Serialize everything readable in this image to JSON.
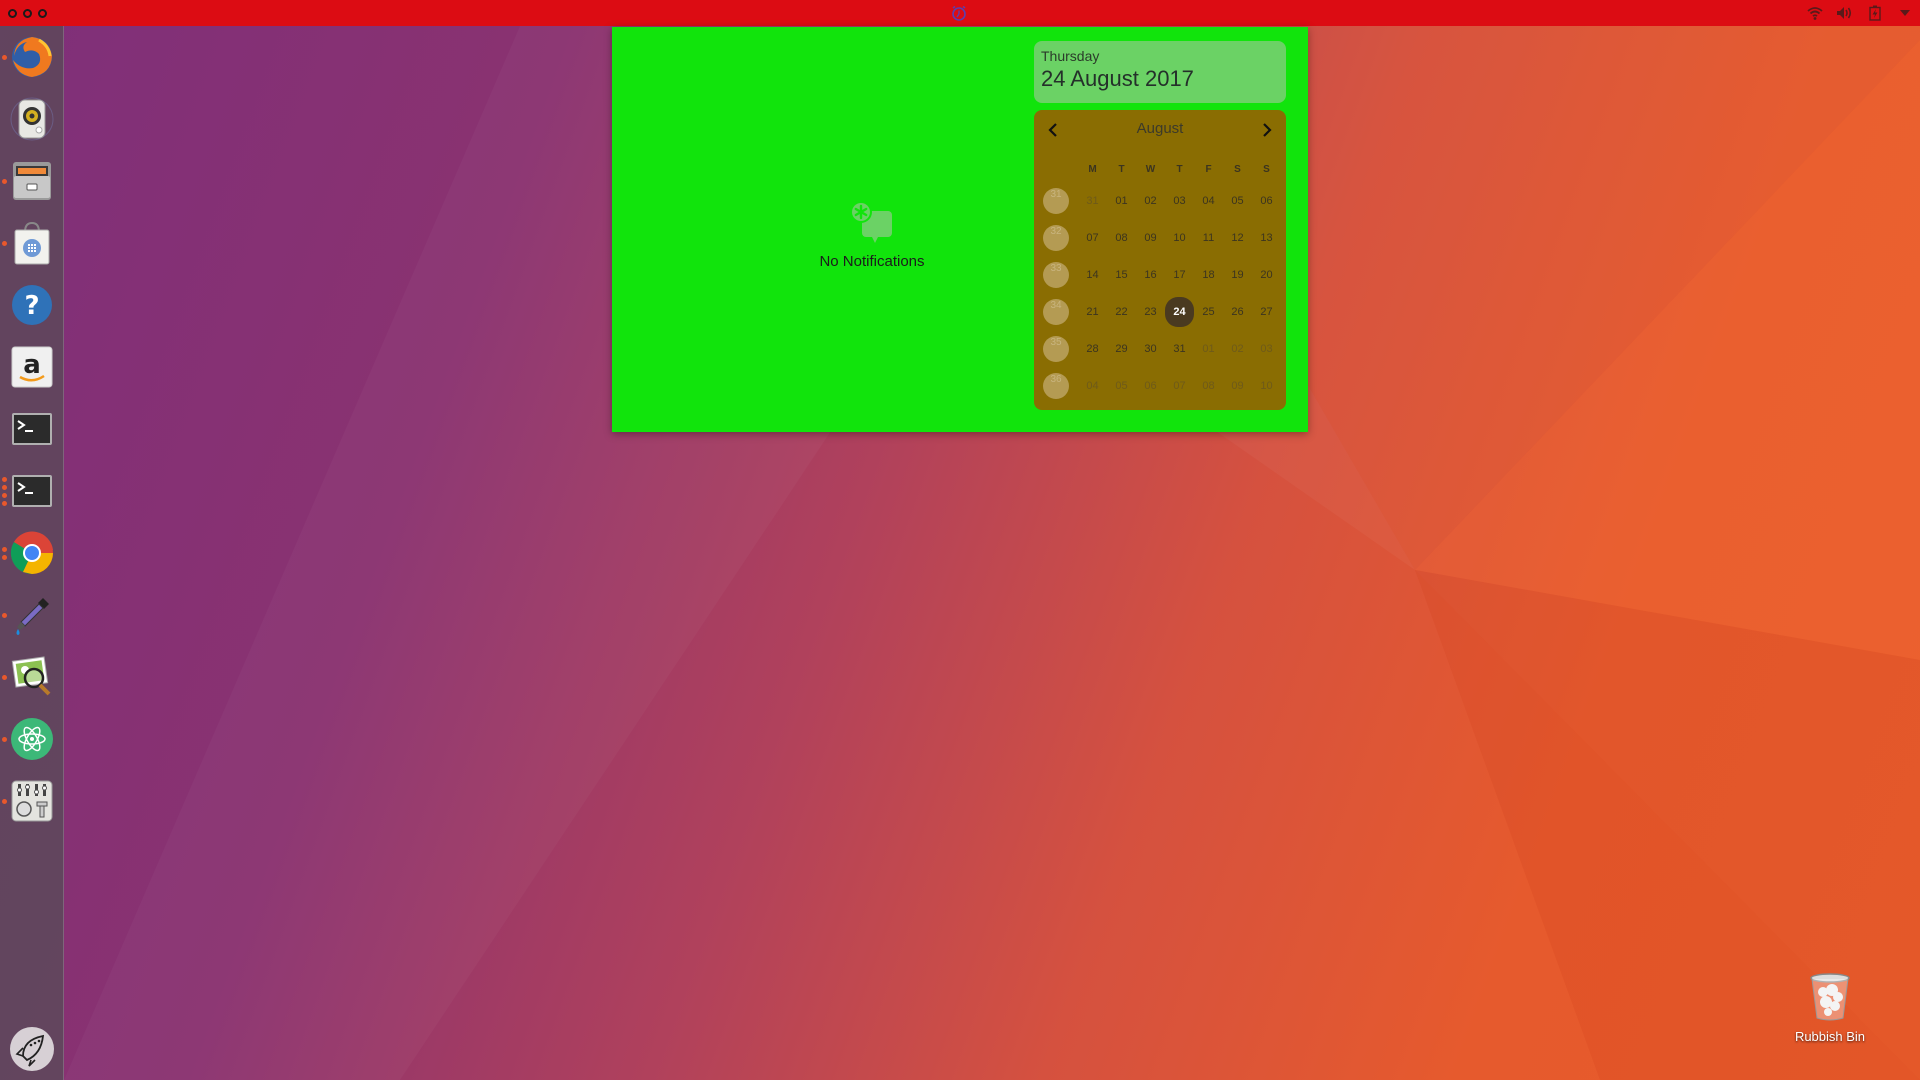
{
  "top_panel": {
    "window_controls": [
      "close",
      "minimize",
      "maximize"
    ],
    "center_indicator": "alarm-clock-icon",
    "indicators": [
      "network-wifi-icon",
      "volume-icon",
      "battery-charging-icon",
      "system-menu-chevron-icon"
    ]
  },
  "launcher": {
    "items": [
      {
        "name": "Firefox Web Browser",
        "icon": "firefox-icon",
        "running_pips": 1
      },
      {
        "name": "Rhythmbox",
        "icon": "speaker-icon",
        "running_pips": 0
      },
      {
        "name": "Files",
        "icon": "file-cabinet-icon",
        "running_pips": 1
      },
      {
        "name": "Ubuntu Software",
        "icon": "shopping-bag-icon",
        "running_pips": 1
      },
      {
        "name": "Help",
        "icon": "help-icon",
        "running_pips": 0
      },
      {
        "name": "Amazon",
        "icon": "amazon-icon",
        "running_pips": 0
      },
      {
        "name": "Terminal",
        "icon": "terminal-icon",
        "running_pips": 0
      },
      {
        "name": "Terminal",
        "icon": "terminal-icon",
        "running_pips": 4
      },
      {
        "name": "Google Chrome",
        "icon": "chrome-icon",
        "running_pips": 2
      },
      {
        "name": "Color Picker",
        "icon": "eyedropper-icon",
        "running_pips": 1
      },
      {
        "name": "Image Viewer",
        "icon": "image-magnifier-icon",
        "running_pips": 1
      },
      {
        "name": "Atom",
        "icon": "atom-icon",
        "running_pips": 1
      },
      {
        "name": "Sound Mixer",
        "icon": "mixer-icon",
        "running_pips": 1
      }
    ],
    "bottom_item": {
      "name": "Launcher Tool",
      "icon": "rocket-icon"
    }
  },
  "notification_panel": {
    "empty_text": "No Notifications",
    "date": {
      "weekday": "Thursday",
      "full_date": "24 August 2017"
    },
    "calendar": {
      "month": "August",
      "prev_label": "‹",
      "next_label": "›",
      "weekday_headers": [
        "M",
        "T",
        "W",
        "T",
        "F",
        "S",
        "S"
      ],
      "weeks": [
        {
          "week_number": "31",
          "days": [
            {
              "d": "31",
              "other": true
            },
            {
              "d": "01"
            },
            {
              "d": "02"
            },
            {
              "d": "03"
            },
            {
              "d": "04"
            },
            {
              "d": "05"
            },
            {
              "d": "06"
            }
          ]
        },
        {
          "week_number": "32",
          "days": [
            {
              "d": "07"
            },
            {
              "d": "08"
            },
            {
              "d": "09"
            },
            {
              "d": "10"
            },
            {
              "d": "11"
            },
            {
              "d": "12"
            },
            {
              "d": "13"
            }
          ]
        },
        {
          "week_number": "33",
          "days": [
            {
              "d": "14"
            },
            {
              "d": "15"
            },
            {
              "d": "16"
            },
            {
              "d": "17"
            },
            {
              "d": "18"
            },
            {
              "d": "19"
            },
            {
              "d": "20"
            }
          ]
        },
        {
          "week_number": "34",
          "days": [
            {
              "d": "21"
            },
            {
              "d": "22"
            },
            {
              "d": "23"
            },
            {
              "d": "24",
              "today": true
            },
            {
              "d": "25"
            },
            {
              "d": "26"
            },
            {
              "d": "27"
            }
          ]
        },
        {
          "week_number": "35",
          "days": [
            {
              "d": "28"
            },
            {
              "d": "29"
            },
            {
              "d": "30"
            },
            {
              "d": "31"
            },
            {
              "d": "01",
              "other": true
            },
            {
              "d": "02",
              "other": true
            },
            {
              "d": "03",
              "other": true
            }
          ]
        },
        {
          "week_number": "36",
          "days": [
            {
              "d": "04",
              "other": true
            },
            {
              "d": "05",
              "other": true
            },
            {
              "d": "06",
              "other": true
            },
            {
              "d": "07",
              "other": true
            },
            {
              "d": "08",
              "other": true
            },
            {
              "d": "09",
              "other": true
            },
            {
              "d": "10",
              "other": true
            }
          ]
        }
      ]
    }
  },
  "desktop": {
    "icons": [
      {
        "label": "Rubbish Bin",
        "icon": "trash-icon"
      }
    ]
  },
  "colors": {
    "top_panel": "#dc0c13",
    "notification_bg": "#11e40c",
    "date_header_bg": "#6bd265",
    "calendar_bg": "#8a6d02",
    "today_bg": "#4a3a20",
    "launcher_pip": "#e8582c"
  }
}
